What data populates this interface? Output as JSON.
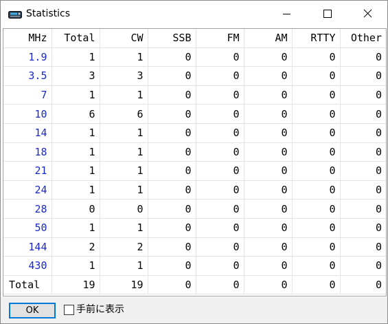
{
  "window": {
    "title": "Statistics",
    "icon": "radio-icon"
  },
  "table": {
    "headers": [
      "MHz",
      "Total",
      "CW",
      "SSB",
      "FM",
      "AM",
      "RTTY",
      "Other"
    ],
    "rows": [
      [
        "1.9",
        "1",
        "1",
        "0",
        "0",
        "0",
        "0",
        "0"
      ],
      [
        "3.5",
        "3",
        "3",
        "0",
        "0",
        "0",
        "0",
        "0"
      ],
      [
        "7",
        "1",
        "1",
        "0",
        "0",
        "0",
        "0",
        "0"
      ],
      [
        "10",
        "6",
        "6",
        "0",
        "0",
        "0",
        "0",
        "0"
      ],
      [
        "14",
        "1",
        "1",
        "0",
        "0",
        "0",
        "0",
        "0"
      ],
      [
        "18",
        "1",
        "1",
        "0",
        "0",
        "0",
        "0",
        "0"
      ],
      [
        "21",
        "1",
        "1",
        "0",
        "0",
        "0",
        "0",
        "0"
      ],
      [
        "24",
        "1",
        "1",
        "0",
        "0",
        "0",
        "0",
        "0"
      ],
      [
        "28",
        "0",
        "0",
        "0",
        "0",
        "0",
        "0",
        "0"
      ],
      [
        "50",
        "1",
        "1",
        "0",
        "0",
        "0",
        "0",
        "0"
      ],
      [
        "144",
        "2",
        "2",
        "0",
        "0",
        "0",
        "0",
        "0"
      ],
      [
        "430",
        "1",
        "1",
        "0",
        "0",
        "0",
        "0",
        "0"
      ]
    ],
    "total_row": [
      "Total",
      "19",
      "19",
      "0",
      "0",
      "0",
      "0",
      "0"
    ]
  },
  "footer": {
    "ok_label": "OK",
    "checkbox_label": "手前に表示",
    "checkbox_checked": false
  },
  "colors": {
    "mhz_text": "#1a27c9",
    "accent": "#0078d7"
  }
}
